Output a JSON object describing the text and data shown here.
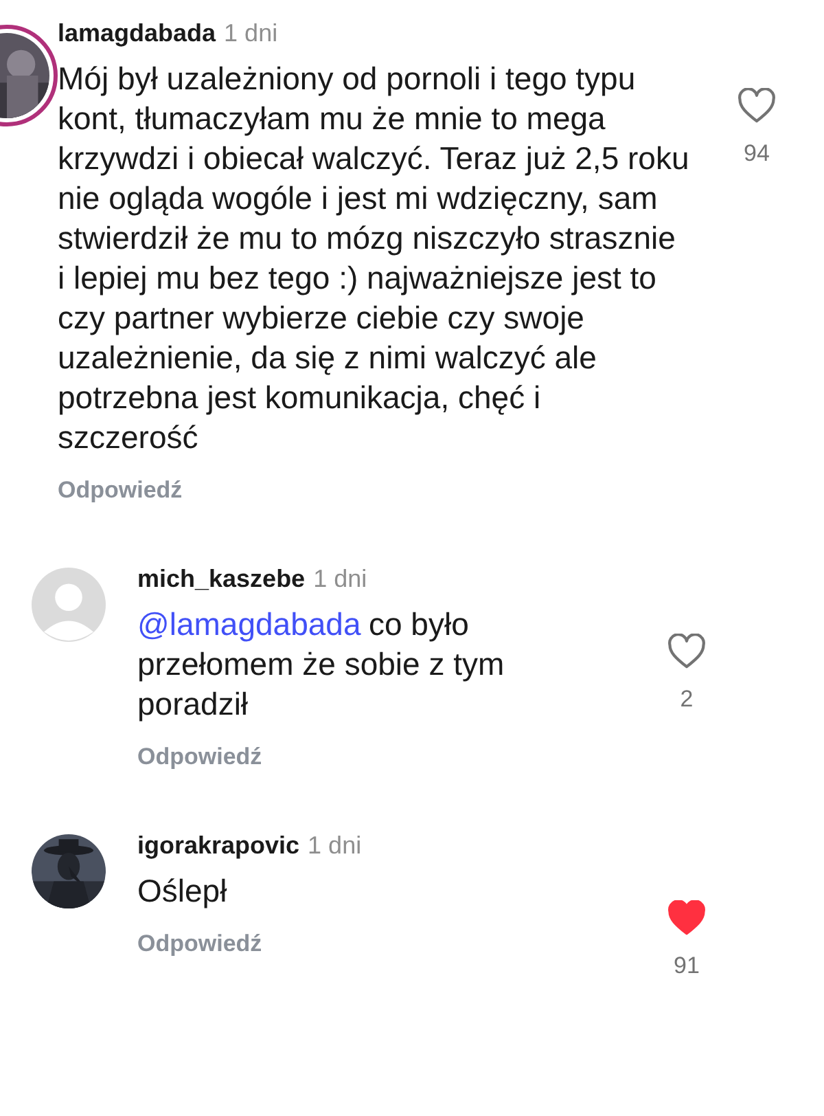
{
  "comments": [
    {
      "username": "lamagdabada",
      "time": "1 dni",
      "story_ring": true,
      "text": "Mój był uzależniony od pornoli i tego typu kont, tłumaczyłam mu że mnie to mega krzywdzi i obiecał walczyć. Teraz już 2,5 roku nie ogląda wogóle i jest mi wdzięczny, sam stwierdził że mu to mózg niszczyło strasznie i lepiej mu bez tego :) najważniejsze jest to czy partner wybierze ciebie czy swoje uzależnienie, da się z nimi walczyć ale potrzebna jest komunikacja, chęć i szczerość",
      "liked": false,
      "likes": "94",
      "reply": "Odpowiedź"
    },
    {
      "username": "mich_kaszebe",
      "time": "1 dni",
      "kind": "default",
      "story_ring": false,
      "mention": "@lamagdabada",
      "text": "co było przełomem że sobie z tym poradził",
      "liked": false,
      "likes": "2",
      "reply": "Odpowiedź"
    },
    {
      "username": "igorakrapovic",
      "time": "1 dni",
      "story_ring": false,
      "text": "Oślepł",
      "liked": true,
      "likes": "91",
      "reply": "Odpowiedź"
    }
  ]
}
